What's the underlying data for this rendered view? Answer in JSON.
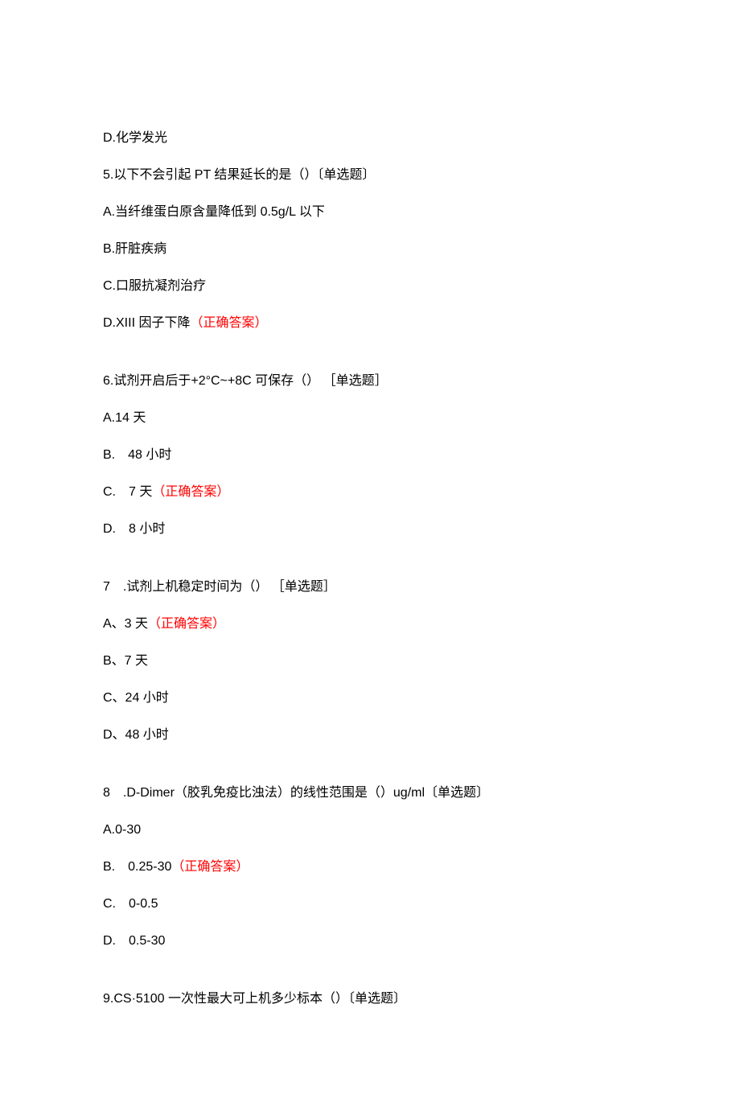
{
  "l1": "D.化学发光",
  "l2": "5.以下不会引起 PT 结果延长的是（）〔单选题〕",
  "l3": "A.当纤维蛋白原含量降低到 0.5g/L 以下",
  "l4": "B.肝脏疾病",
  "l5": "C.口服抗凝剂治疗",
  "l6a": "D.XIII 因子下降",
  "l6b": "（正确答案）",
  "l7": "6.试剂开启后于+2°C~+8C 可保存（） ［单选题］",
  "l8": "A.14 天",
  "l9": "B.　48 小时",
  "l10a": "C.　7 天",
  "l10b": "（正确答案）",
  "l11": "D.　8 小时",
  "l12": "7　.试剂上机稳定时间为（） ［单选题］",
  "l13a": "A、3 天",
  "l13b": "（正确答案）",
  "l14": "B、7 天",
  "l15": "C、24 小时",
  "l16": "D、48 小时",
  "l17": "8　.D-Dimer（胶乳免疫比浊法）的线性范围是（）ug/ml〔单选题〕",
  "l18": "A.0-30",
  "l19a": "B.　0.25-30",
  "l19b": "（正确答案）",
  "l20": "C.　0-0.5",
  "l21": "D.　0.5-30",
  "l22": "9.CS·5100 一次性最大可上机多少标本（）〔单选题〕"
}
